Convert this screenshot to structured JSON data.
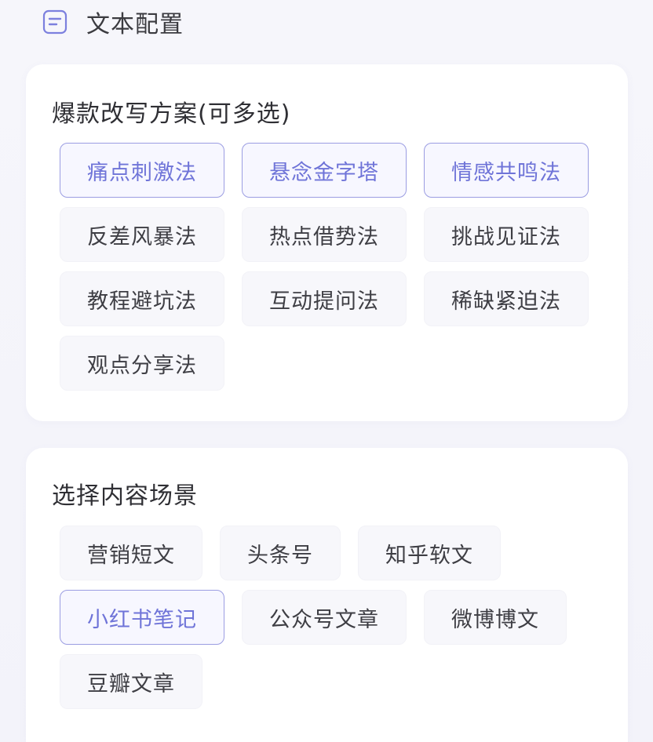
{
  "header": {
    "title": "文本配置",
    "icon": "text-list-icon",
    "accent_color": "#6f74d8"
  },
  "rewrite_section": {
    "title": "爆款改写方案(可多选)",
    "options": [
      {
        "label": "痛点刺激法",
        "selected": true
      },
      {
        "label": "悬念金字塔",
        "selected": true
      },
      {
        "label": "情感共鸣法",
        "selected": true
      },
      {
        "label": "反差风暴法",
        "selected": false
      },
      {
        "label": "热点借势法",
        "selected": false
      },
      {
        "label": "挑战见证法",
        "selected": false
      },
      {
        "label": "教程避坑法",
        "selected": false
      },
      {
        "label": "互动提问法",
        "selected": false
      },
      {
        "label": "稀缺紧迫法",
        "selected": false
      },
      {
        "label": "观点分享法",
        "selected": false
      }
    ]
  },
  "scene_section": {
    "title": "选择内容场景",
    "options": [
      {
        "label": "营销短文",
        "selected": false
      },
      {
        "label": "头条号",
        "selected": false
      },
      {
        "label": "知乎软文",
        "selected": false
      },
      {
        "label": "小红书笔记",
        "selected": true
      },
      {
        "label": "公众号文章",
        "selected": false
      },
      {
        "label": "微博博文",
        "selected": false
      },
      {
        "label": "豆瓣文章",
        "selected": false
      }
    ]
  },
  "colors": {
    "selected_border": "#9b9de2",
    "selected_text": "#6f74d8",
    "chip_background": "#f7f7fb"
  }
}
